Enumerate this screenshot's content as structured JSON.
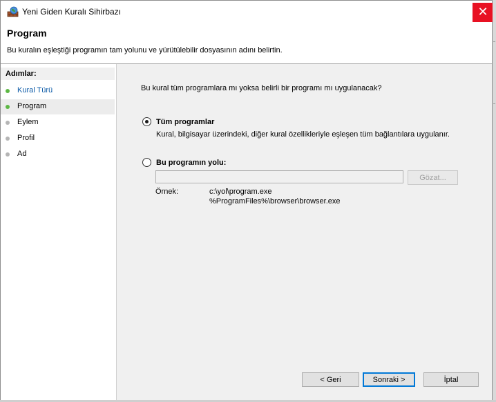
{
  "window": {
    "title": "Yeni Giden Kuralı Sihirbazı",
    "close_glyph": "✕",
    "icon": "firewall-icon"
  },
  "header": {
    "title": "Program",
    "description": "Bu kuralın eşleştiği programın tam yolunu ve yürütülebilir dosyasının adını belirtin."
  },
  "sidebar": {
    "title": "Adımlar:",
    "steps": [
      {
        "label": "Kural Türü",
        "state": "done"
      },
      {
        "label": "Program",
        "state": "current"
      },
      {
        "label": "Eylem",
        "state": "pending"
      },
      {
        "label": "Profil",
        "state": "pending"
      },
      {
        "label": "Ad",
        "state": "pending"
      }
    ]
  },
  "main": {
    "question": "Bu kural tüm programlara mı yoksa belirli bir programı mı uygulanacak?",
    "all_programs": {
      "label": "Tüm programlar",
      "description": "Kural, bilgisayar üzerindeki, diğer kural özellikleriyle eşleşen tüm bağlantılara uygulanır.",
      "selected": true
    },
    "this_program": {
      "label": "Bu programın yolu:",
      "selected": false,
      "path_value": "",
      "browse_label": "Gözat..."
    },
    "example_label": "Örnek:",
    "example_lines": [
      "c:\\yol\\program.exe",
      "%ProgramFiles%\\browser\\browser.exe"
    ]
  },
  "footer": {
    "back_label": "< Geri",
    "next_label": "Sonraki >",
    "cancel_label": "İptal"
  },
  "colors": {
    "close_button": "#e81123",
    "step_done_dot": "#5db844",
    "step_pending_dot": "#b5b5b5",
    "step_done_text": "#0b5aa7",
    "accent": "#0078d7"
  }
}
